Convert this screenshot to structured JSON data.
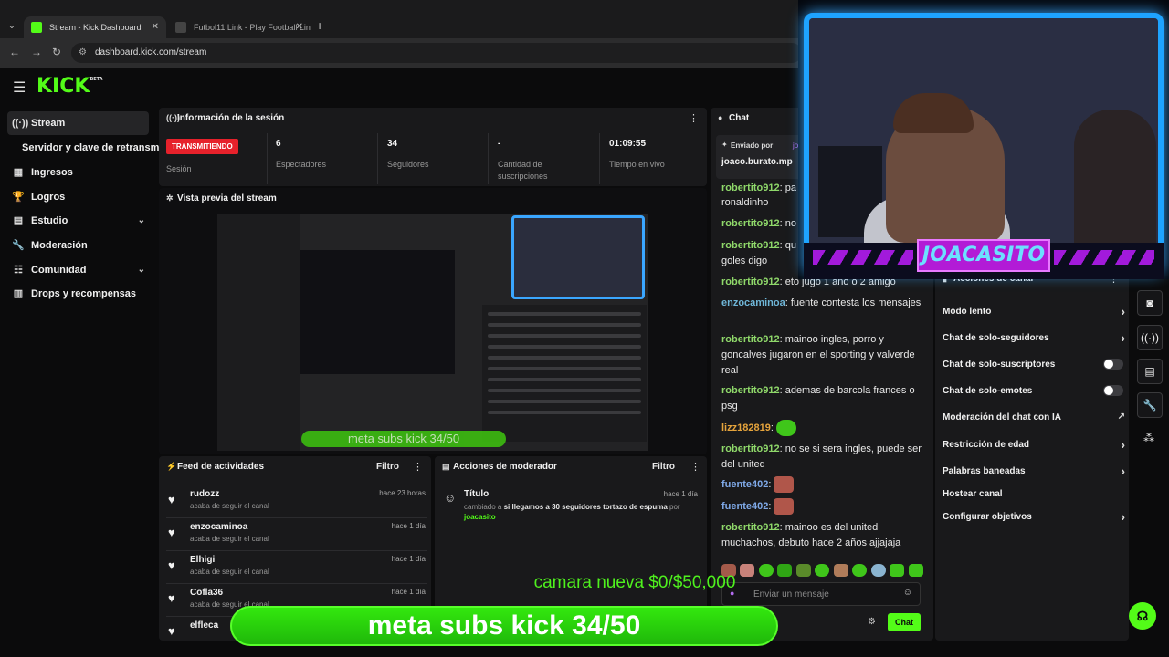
{
  "browser": {
    "tabs": [
      {
        "title": "Stream - Kick Dashboard"
      },
      {
        "title": "Futbol11 Link - Play Football Lin"
      }
    ],
    "url": "dashboard.kick.com/stream"
  },
  "brand": {
    "logo": "KICK",
    "beta": "BETA",
    "accent": "#53fc18"
  },
  "sidebar": {
    "items": [
      {
        "label": "Stream",
        "icon": "broadcast-icon"
      },
      {
        "label": "Servidor y clave de retransmisión"
      },
      {
        "label": "Ingresos",
        "icon": "chart-icon"
      },
      {
        "label": "Logros",
        "icon": "trophy-icon"
      },
      {
        "label": "Estudio",
        "icon": "studio-icon"
      },
      {
        "label": "Moderación",
        "icon": "wrench-icon"
      },
      {
        "label": "Comunidad",
        "icon": "community-icon"
      },
      {
        "label": "Drops y recompensas",
        "icon": "drops-icon"
      }
    ]
  },
  "session": {
    "title": "Información de la sesión",
    "status": "TRANSMITIENDO",
    "status_label": "Sesión",
    "stats": [
      {
        "value": "6",
        "label": "Espectadores"
      },
      {
        "value": "34",
        "label": "Seguidores"
      },
      {
        "value": "-",
        "label": "Cantidad de suscripciones"
      },
      {
        "value": "01:09:55",
        "label": "Tiempo en vivo"
      }
    ]
  },
  "preview": {
    "title": "Vista previa del stream",
    "overlay_text": "meta subs kick 34/50"
  },
  "feed": {
    "title": "Feed de actividades",
    "filter": "Filtro",
    "items": [
      {
        "name": "rudozz",
        "desc": "acaba de seguir el canal",
        "time": "hace 23 horas"
      },
      {
        "name": "enzocaminoa",
        "desc": "acaba de seguir el canal",
        "time": "hace 1 día"
      },
      {
        "name": "Elhigi",
        "desc": "acaba de seguir el canal",
        "time": "hace 1 día"
      },
      {
        "name": "Cofla36",
        "desc": "acaba de seguir el canal",
        "time": "hace 1 día"
      },
      {
        "name": "elfleca",
        "desc": "",
        "time": ""
      }
    ]
  },
  "mod": {
    "title": "Acciones de moderador",
    "filter": "Filtro",
    "item": {
      "label": "Título",
      "time": "hace 1 día",
      "prefix": "cambiado a",
      "value": "si llegamos a 30 seguidores tortazo de espuma",
      "by": "por",
      "user": "joacasito"
    }
  },
  "chat": {
    "title": "Chat",
    "pinned_label": "Enviado por",
    "pinned_user": "joa",
    "pinned_text": "joaco.burato.mp",
    "messages": [
      {
        "user": "robertito912",
        "text": "pa",
        "color": "#8fd86a"
      },
      {
        "user": "",
        "text": "ronaldinho",
        "color": "#8fd86a"
      },
      {
        "user": "robertito912",
        "text": "no",
        "color": "#8fd86a"
      },
      {
        "user": "robertito912",
        "text": "qu",
        "color": "#8fd86a"
      },
      {
        "user": "",
        "text": "goles digo",
        "color": "#8fd86a"
      },
      {
        "user": "robertito912",
        "text": "eto jugo 1 año o 2 amigo",
        "color": "#8fd86a"
      },
      {
        "user": "enzocaminoa",
        "text": "fuente contesta los mensajes",
        "color": "#6fb6d8"
      },
      {
        "user": "robertito912",
        "text": "mainoo ingles, porro y goncalves jugaron en el sporting y valverde real",
        "color": "#8fd86a"
      },
      {
        "user": "robertito912",
        "text": "ademas de barcola frances o psg",
        "color": "#8fd86a"
      },
      {
        "user": "lizz182819",
        "text": "",
        "color": "#e6a43c"
      },
      {
        "user": "robertito912",
        "text": "no se si sera ingles, puede ser del united",
        "color": "#8fd86a"
      },
      {
        "user": "fuente402",
        "text": "",
        "color": "#7fa9e8"
      },
      {
        "user": "fuente402",
        "text": "",
        "color": "#7fa9e8"
      },
      {
        "user": "robertito912",
        "text": "mainoo es del united muchachos, debuto hace 2 años ajjajaja",
        "color": "#8fd86a"
      }
    ],
    "input_placeholder": "Enviar un mensaje",
    "send_label": "Chat"
  },
  "channel_actions": {
    "title": "Acciones de canal",
    "items": [
      {
        "label": "Modo lento",
        "control": "arrow"
      },
      {
        "label": "Chat de solo-seguidores",
        "control": "arrow"
      },
      {
        "label": "Chat de solo-suscriptores",
        "control": "toggle"
      },
      {
        "label": "Chat de solo-emotes",
        "control": "toggle"
      },
      {
        "label": "Moderación del chat con IA",
        "control": "external"
      },
      {
        "label": "Restricción de edad",
        "control": "arrow"
      },
      {
        "label": "Palabras baneadas",
        "control": "arrow"
      },
      {
        "label": "Hostear canal",
        "control": "none"
      },
      {
        "label": "Configurar objetivos",
        "control": "arrow"
      }
    ]
  },
  "overlay": {
    "cam_name": "JOACASITO",
    "goal_secondary": "camara nueva $0/$50,000",
    "goal_main": "meta subs kick 34/50"
  }
}
